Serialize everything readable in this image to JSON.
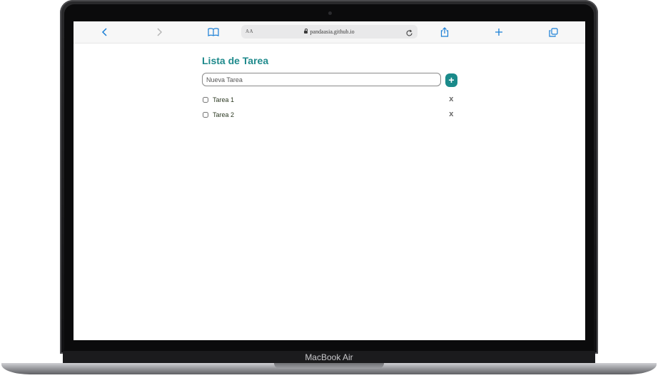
{
  "device": {
    "label": "MacBook Air"
  },
  "browser": {
    "address_bar": {
      "text_size_label": "AA",
      "url": "pandaasia.github.io"
    }
  },
  "app": {
    "title": "Lista de Tarea",
    "new_task": {
      "placeholder": "Nueva Tarea",
      "value": ""
    },
    "add_button_label": "+",
    "tasks": [
      {
        "label": "Tarea 1",
        "checked": false,
        "delete_label": "x"
      },
      {
        "label": "Tarea 2",
        "checked": false,
        "delete_label": "x"
      }
    ]
  },
  "colors": {
    "accent": "#1f8a8c",
    "browser_icon": "#1a7fd6",
    "task_text": "#2d3a23"
  },
  "icons": [
    "back-icon",
    "forward-icon",
    "bookmarks-icon",
    "lock-icon",
    "reload-icon",
    "share-icon",
    "new-tab-icon",
    "tabs-overview-icon"
  ]
}
